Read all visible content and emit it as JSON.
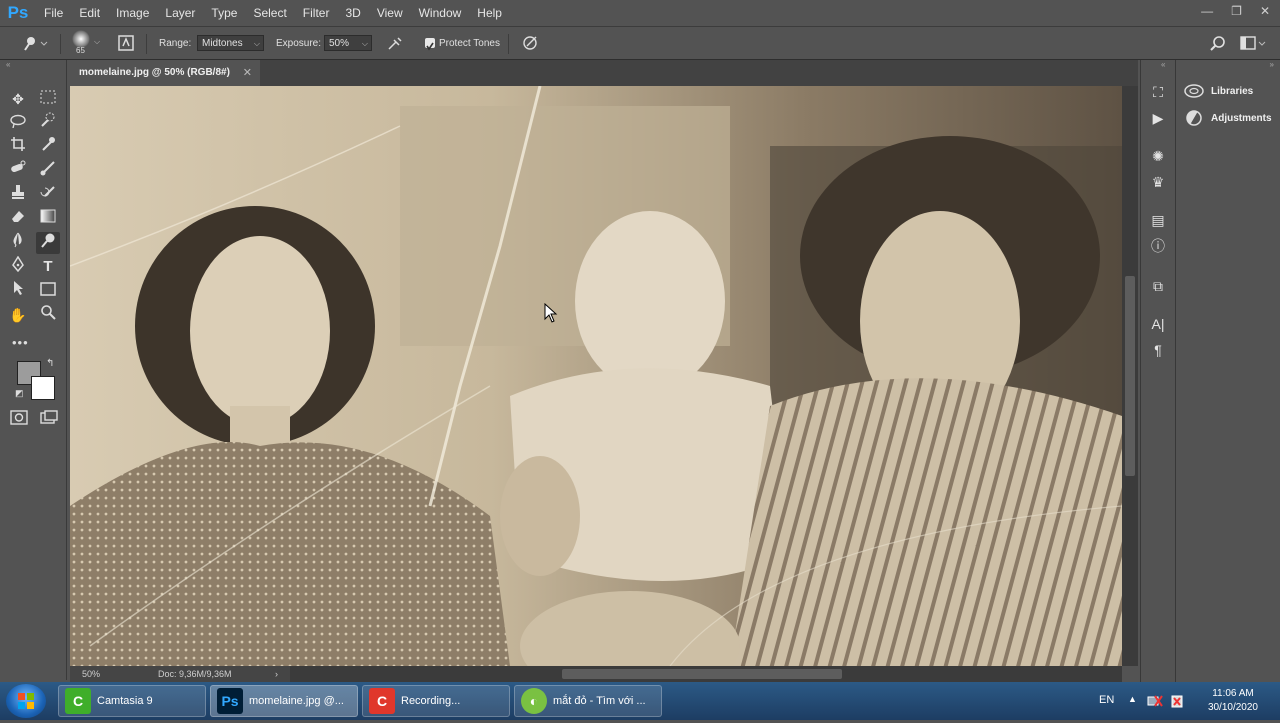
{
  "app": {
    "logo": "Ps"
  },
  "menu": [
    "File",
    "Edit",
    "Image",
    "Layer",
    "Type",
    "Select",
    "Filter",
    "3D",
    "View",
    "Window",
    "Help"
  ],
  "window_controls": {
    "minimize": "—",
    "restore": "❐",
    "close": "✕"
  },
  "options": {
    "brush_size": "65",
    "range_label": "Range:",
    "range_value": "Midtones",
    "exposure_label": "Exposure:",
    "exposure_value": "50%",
    "protect_tones_label": "Protect Tones",
    "protect_tones_checked": true
  },
  "document": {
    "tab_title": "momelaine.jpg @ 50% (RGB/8#)",
    "zoom": "50%",
    "doc_info": "Doc: 9,36M/9,36M"
  },
  "tools": [
    "move-icon",
    "marquee-icon",
    "lasso-icon",
    "quick-select-icon",
    "crop-icon",
    "eyedropper-icon",
    "spot-heal-icon",
    "brush-icon",
    "stamp-icon",
    "history-brush-icon",
    "eraser-icon",
    "gradient-icon",
    "blur-icon",
    "dodge-icon",
    "pen-icon",
    "type-icon",
    "path-select-icon",
    "rectangle-icon",
    "hand-icon",
    "zoom-icon"
  ],
  "colors": {
    "foreground": "#9c9c9c",
    "background": "#ffffff",
    "accent": "#31a8ff"
  },
  "panels": {
    "libraries": "Libraries",
    "adjustments": "Adjustments"
  },
  "taskbar": {
    "items": [
      {
        "label": "Camtasia 9",
        "icon": "camtasia-icon"
      },
      {
        "label": "momelaine.jpg @...",
        "icon": "photoshop-icon"
      },
      {
        "label": "Recording...",
        "icon": "recorder-icon"
      },
      {
        "label": "mắt đỏ - Tìm với ...",
        "icon": "coccoc-icon"
      }
    ],
    "language": "EN",
    "time": "11:06 AM",
    "date": "30/10/2020"
  }
}
